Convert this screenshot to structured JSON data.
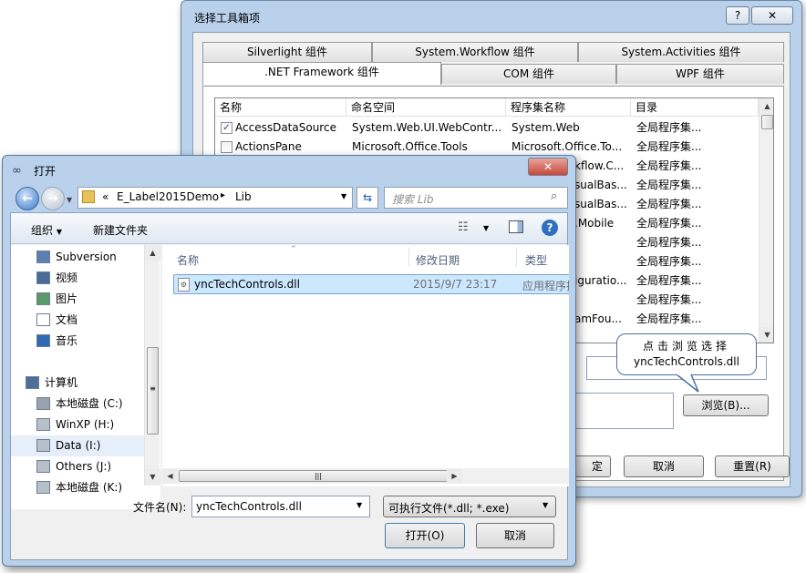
{
  "toolbox": {
    "title": "选择工具箱项",
    "help_btn": "?",
    "close_btn": "✕",
    "tabs_top": [
      "Silverlight 组件",
      "System.Workflow 组件",
      "System.Activities 组件"
    ],
    "tabs_bottom": [
      ".NET Framework 组件",
      "COM 组件",
      "WPF 组件"
    ],
    "columns": [
      "名称",
      "命名空间",
      "程序集名称",
      "目录"
    ],
    "rows": [
      {
        "name": "AccessDataSource",
        "ns": "System.Web.UI.WebContr...",
        "asm": "System.Web",
        "dir": "全局程序集..."
      },
      {
        "name": "ActionsPane",
        "ns": "Microsoft.Office.Tools",
        "asm": "Microsoft.Office.To...",
        "dir": "全局程序集..."
      },
      {
        "name": "",
        "ns": "",
        "asm": "kflow.C...",
        "dir": "全局程序集..."
      },
      {
        "name": "",
        "ns": "",
        "asm": "sualBas...",
        "dir": "全局程序集..."
      },
      {
        "name": "",
        "ns": "",
        "asm": "sualBas...",
        "dir": "全局程序集..."
      },
      {
        "name": "",
        "ns": "",
        "asm": ".Mobile",
        "dir": "全局程序集..."
      },
      {
        "name": "",
        "ns": "",
        "asm": "",
        "dir": "全局程序集..."
      },
      {
        "name": "",
        "ns": "",
        "asm": "",
        "dir": "全局程序集..."
      },
      {
        "name": "",
        "ns": "",
        "asm": "iguratio...",
        "dir": "全局程序集..."
      },
      {
        "name": "",
        "ns": "",
        "asm": "",
        "dir": "全局程序集..."
      },
      {
        "name": "",
        "ns": "",
        "asm": "amFou...",
        "dir": "全局程序集..."
      }
    ],
    "browse_btn": "浏览(B)...",
    "ok_btn_partial": "定",
    "cancel_btn": "取消",
    "reset_btn": "重置(R)"
  },
  "tooltip": {
    "line1": "点击浏览选择",
    "line2": "yncTechControls.dll"
  },
  "open_dialog": {
    "title": "打开",
    "breadcrumb": {
      "chevrons": "«",
      "folder": "E_Label2015Demo",
      "sep": "▸",
      "sub": "Lib"
    },
    "search_placeholder": "搜索 Lib",
    "organize": "组织",
    "new_folder": "新建文件夹",
    "nav": [
      {
        "label": "Subversion",
        "icon": "subversion-icon"
      },
      {
        "label": "视频",
        "icon": "video-icon"
      },
      {
        "label": "图片",
        "icon": "picture-icon"
      },
      {
        "label": "文档",
        "icon": "document-icon"
      },
      {
        "label": "音乐",
        "icon": "music-icon"
      },
      {
        "label": "计算机",
        "icon": "computer-icon"
      },
      {
        "label": "本地磁盘 (C:)",
        "icon": "local-disk-icon"
      },
      {
        "label": "WinXP (H:)",
        "icon": "drive-icon"
      },
      {
        "label": "Data (I:)",
        "icon": "drive-icon"
      },
      {
        "label": "Others (J:)",
        "icon": "drive-icon"
      },
      {
        "label": "本地磁盘 (K:)",
        "icon": "drive-icon"
      }
    ],
    "columns": [
      "名称",
      "修改日期",
      "类型"
    ],
    "files": [
      {
        "name": "yncTechControls.dll",
        "date": "2015/9/7 23:17",
        "type": "应用程序扩展"
      }
    ],
    "filename_label": "文件名(N):",
    "filename_value": "yncTechControls.dll",
    "filter_value": "可执行文件(*.dll; *.exe)",
    "open_btn": "打开(O)",
    "cancel_btn": "取消"
  },
  "colors": {
    "window_frame": "#b9d1ea",
    "selection": "#cce8ff",
    "selection_border": "#7da2ce"
  }
}
